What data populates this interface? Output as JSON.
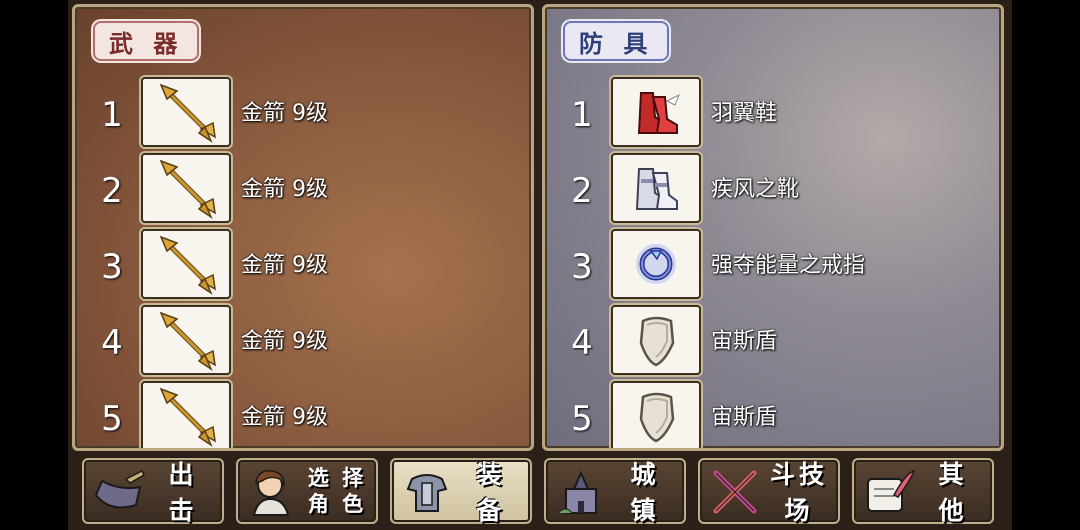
{
  "weapons": {
    "title": "武 器",
    "slots": [
      {
        "num": "1",
        "name": "金箭 9级",
        "icon": "golden-arrow-icon"
      },
      {
        "num": "2",
        "name": "金箭 9级",
        "icon": "golden-arrow-icon"
      },
      {
        "num": "3",
        "name": "金箭 9级",
        "icon": "golden-arrow-icon"
      },
      {
        "num": "4",
        "name": "金箭 9级",
        "icon": "golden-arrow-icon"
      },
      {
        "num": "5",
        "name": "金箭 9级",
        "icon": "golden-arrow-icon"
      }
    ]
  },
  "armor": {
    "title": "防 具",
    "slots": [
      {
        "num": "1",
        "name": "羽翼鞋",
        "icon": "red-boots-icon"
      },
      {
        "num": "2",
        "name": "疾风之靴",
        "icon": "silver-boots-icon"
      },
      {
        "num": "3",
        "name": "强夺能量之戒指",
        "icon": "ring-icon"
      },
      {
        "num": "4",
        "name": "宙斯盾",
        "icon": "shield-icon"
      },
      {
        "num": "5",
        "name": "宙斯盾",
        "icon": "shield-icon"
      }
    ]
  },
  "toolbar": {
    "sortie": "出 击",
    "select_role": "选 择\n角 色",
    "equip": "装 备",
    "town": "城 镇",
    "arena": "斗技场",
    "other": "其 他"
  },
  "colors": {
    "weapon_panel": "#8c5d40",
    "armor_panel": "#8f8a94",
    "active_button": "#e9e0c6"
  }
}
